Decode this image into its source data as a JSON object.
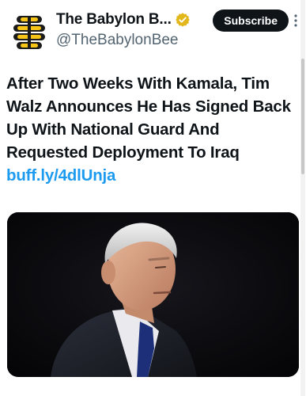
{
  "account": {
    "display_name": "The Babylon B...",
    "handle": "@TheBabylonBee",
    "verified_icon": "gold-verified-badge-icon",
    "avatar_icon": "babylon-bee-logo-icon"
  },
  "actions": {
    "subscribe_label": "Subscribe",
    "more_icon": "more-options-icon"
  },
  "tweet": {
    "text": "After Two Weeks With Kamala, Tim Walz Announces He Has Signed Back Up With National Guard And Requested Deployment To Iraq",
    "link_text": "buff.ly/4dlUnja"
  },
  "media": {
    "type": "photo"
  },
  "colors": {
    "text": "#0f1419",
    "secondary": "#536471",
    "link": "#1d9bf0",
    "verified_gold": "#e2b719",
    "logo_yellow": "#f6c518"
  }
}
